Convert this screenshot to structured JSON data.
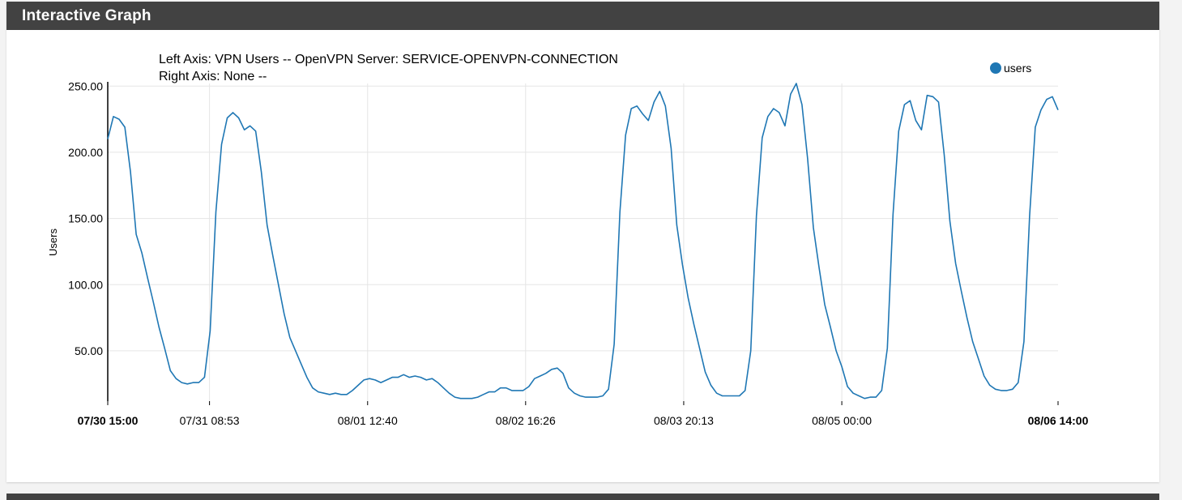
{
  "panel": {
    "title": "Interactive Graph"
  },
  "colors": {
    "header_bg": "#424242",
    "line": "#1f77b4",
    "grid": "#e5e5e5"
  },
  "chart_data": {
    "type": "line",
    "left_axis_title": "Left Axis: VPN Users -- OpenVPN Server: SERVICE-OPENVPN-CONNECTION",
    "right_axis_title": "Right Axis: None --",
    "ylabel": "Users",
    "ylim": [
      12,
      252
    ],
    "y_ticks": [
      {
        "value": 50,
        "label": "50.00"
      },
      {
        "value": 100,
        "label": "100.00"
      },
      {
        "value": 150,
        "label": "150.00"
      },
      {
        "value": 200,
        "label": "200.00"
      },
      {
        "value": 250,
        "label": "250.00"
      }
    ],
    "xlim": [
      "2019-07-30T15:00",
      "2019-08-06T14:00"
    ],
    "x_ticks": [
      {
        "t": "2019-07-30T15:00",
        "label": "07/30 15:00",
        "bold": true
      },
      {
        "t": "2019-07-31T08:53",
        "label": "07/31 08:53",
        "bold": false
      },
      {
        "t": "2019-08-01T12:40",
        "label": "08/01 12:40",
        "bold": false
      },
      {
        "t": "2019-08-02T16:26",
        "label": "08/02 16:26",
        "bold": false
      },
      {
        "t": "2019-08-03T20:13",
        "label": "08/03 20:13",
        "bold": false
      },
      {
        "t": "2019-08-05T00:00",
        "label": "08/05 00:00",
        "bold": false
      },
      {
        "t": "2019-08-06T14:00",
        "label": "08/06 14:00",
        "bold": true
      }
    ],
    "legend": {
      "position": "top-right"
    },
    "series": [
      {
        "name": "users",
        "color": "#1f77b4",
        "points": [
          [
            "2019-07-30T15:00",
            210
          ],
          [
            "2019-07-30T16:00",
            227
          ],
          [
            "2019-07-30T17:00",
            225
          ],
          [
            "2019-07-30T18:00",
            219
          ],
          [
            "2019-07-30T19:00",
            185
          ],
          [
            "2019-07-30T20:00",
            138
          ],
          [
            "2019-07-30T21:00",
            124
          ],
          [
            "2019-07-30T22:00",
            105
          ],
          [
            "2019-07-30T23:00",
            87
          ],
          [
            "2019-07-31T00:00",
            68
          ],
          [
            "2019-07-31T01:00",
            52
          ],
          [
            "2019-07-31T02:00",
            35
          ],
          [
            "2019-07-31T03:00",
            29
          ],
          [
            "2019-07-31T04:00",
            26
          ],
          [
            "2019-07-31T05:00",
            25
          ],
          [
            "2019-07-31T06:00",
            26
          ],
          [
            "2019-07-31T07:00",
            26
          ],
          [
            "2019-07-31T08:00",
            30
          ],
          [
            "2019-07-31T09:00",
            65
          ],
          [
            "2019-07-31T10:00",
            155
          ],
          [
            "2019-07-31T11:00",
            206
          ],
          [
            "2019-07-31T12:00",
            226
          ],
          [
            "2019-07-31T13:00",
            230
          ],
          [
            "2019-07-31T14:00",
            226
          ],
          [
            "2019-07-31T15:00",
            217
          ],
          [
            "2019-07-31T16:00",
            220
          ],
          [
            "2019-07-31T17:00",
            216
          ],
          [
            "2019-07-31T18:00",
            185
          ],
          [
            "2019-07-31T19:00",
            145
          ],
          [
            "2019-07-31T20:00",
            122
          ],
          [
            "2019-07-31T21:00",
            100
          ],
          [
            "2019-07-31T22:00",
            78
          ],
          [
            "2019-07-31T23:00",
            60
          ],
          [
            "2019-08-01T00:00",
            50
          ],
          [
            "2019-08-01T01:00",
            40
          ],
          [
            "2019-08-01T02:00",
            30
          ],
          [
            "2019-08-01T03:00",
            22
          ],
          [
            "2019-08-01T04:00",
            19
          ],
          [
            "2019-08-01T05:00",
            18
          ],
          [
            "2019-08-01T06:00",
            17
          ],
          [
            "2019-08-01T07:00",
            18
          ],
          [
            "2019-08-01T08:00",
            17
          ],
          [
            "2019-08-01T09:00",
            17
          ],
          [
            "2019-08-01T10:00",
            20
          ],
          [
            "2019-08-01T11:00",
            24
          ],
          [
            "2019-08-01T12:00",
            28
          ],
          [
            "2019-08-01T13:00",
            29
          ],
          [
            "2019-08-01T14:00",
            28
          ],
          [
            "2019-08-01T15:00",
            26
          ],
          [
            "2019-08-01T16:00",
            28
          ],
          [
            "2019-08-01T17:00",
            30
          ],
          [
            "2019-08-01T18:00",
            30
          ],
          [
            "2019-08-01T19:00",
            32
          ],
          [
            "2019-08-01T20:00",
            30
          ],
          [
            "2019-08-01T21:00",
            31
          ],
          [
            "2019-08-01T22:00",
            30
          ],
          [
            "2019-08-01T23:00",
            28
          ],
          [
            "2019-08-02T00:00",
            29
          ],
          [
            "2019-08-02T01:00",
            26
          ],
          [
            "2019-08-02T02:00",
            22
          ],
          [
            "2019-08-02T03:00",
            18
          ],
          [
            "2019-08-02T04:00",
            15
          ],
          [
            "2019-08-02T05:00",
            14
          ],
          [
            "2019-08-02T06:00",
            14
          ],
          [
            "2019-08-02T07:00",
            14
          ],
          [
            "2019-08-02T08:00",
            15
          ],
          [
            "2019-08-02T09:00",
            17
          ],
          [
            "2019-08-02T10:00",
            19
          ],
          [
            "2019-08-02T11:00",
            19
          ],
          [
            "2019-08-02T12:00",
            22
          ],
          [
            "2019-08-02T13:00",
            22
          ],
          [
            "2019-08-02T14:00",
            20
          ],
          [
            "2019-08-02T15:00",
            20
          ],
          [
            "2019-08-02T16:00",
            20
          ],
          [
            "2019-08-02T17:00",
            23
          ],
          [
            "2019-08-02T18:00",
            29
          ],
          [
            "2019-08-02T19:00",
            31
          ],
          [
            "2019-08-02T20:00",
            33
          ],
          [
            "2019-08-02T21:00",
            36
          ],
          [
            "2019-08-02T22:00",
            37
          ],
          [
            "2019-08-02T23:00",
            33
          ],
          [
            "2019-08-03T00:00",
            22
          ],
          [
            "2019-08-03T01:00",
            18
          ],
          [
            "2019-08-03T02:00",
            16
          ],
          [
            "2019-08-03T03:00",
            15
          ],
          [
            "2019-08-03T04:00",
            15
          ],
          [
            "2019-08-03T05:00",
            15
          ],
          [
            "2019-08-03T06:00",
            16
          ],
          [
            "2019-08-03T07:00",
            21
          ],
          [
            "2019-08-03T08:00",
            55
          ],
          [
            "2019-08-03T09:00",
            155
          ],
          [
            "2019-08-03T10:00",
            213
          ],
          [
            "2019-08-03T11:00",
            233
          ],
          [
            "2019-08-03T12:00",
            235
          ],
          [
            "2019-08-03T13:00",
            229
          ],
          [
            "2019-08-03T14:00",
            224
          ],
          [
            "2019-08-03T15:00",
            238
          ],
          [
            "2019-08-03T16:00",
            246
          ],
          [
            "2019-08-03T17:00",
            235
          ],
          [
            "2019-08-03T18:00",
            203
          ],
          [
            "2019-08-03T19:00",
            145
          ],
          [
            "2019-08-03T20:00",
            115
          ],
          [
            "2019-08-03T21:00",
            90
          ],
          [
            "2019-08-03T22:00",
            70
          ],
          [
            "2019-08-03T23:00",
            52
          ],
          [
            "2019-08-04T00:00",
            34
          ],
          [
            "2019-08-04T01:00",
            24
          ],
          [
            "2019-08-04T02:00",
            18
          ],
          [
            "2019-08-04T03:00",
            16
          ],
          [
            "2019-08-04T04:00",
            16
          ],
          [
            "2019-08-04T05:00",
            16
          ],
          [
            "2019-08-04T06:00",
            16
          ],
          [
            "2019-08-04T07:00",
            20
          ],
          [
            "2019-08-04T08:00",
            50
          ],
          [
            "2019-08-04T09:00",
            152
          ],
          [
            "2019-08-04T10:00",
            211
          ],
          [
            "2019-08-04T11:00",
            227
          ],
          [
            "2019-08-04T12:00",
            233
          ],
          [
            "2019-08-04T13:00",
            230
          ],
          [
            "2019-08-04T14:00",
            220
          ],
          [
            "2019-08-04T15:00",
            244
          ],
          [
            "2019-08-04T16:00",
            252
          ],
          [
            "2019-08-04T17:00",
            236
          ],
          [
            "2019-08-04T18:00",
            195
          ],
          [
            "2019-08-04T19:00",
            143
          ],
          [
            "2019-08-04T20:00",
            113
          ],
          [
            "2019-08-04T21:00",
            85
          ],
          [
            "2019-08-04T22:00",
            68
          ],
          [
            "2019-08-04T23:00",
            50
          ],
          [
            "2019-08-05T00:00",
            38
          ],
          [
            "2019-08-05T01:00",
            23
          ],
          [
            "2019-08-05T02:00",
            18
          ],
          [
            "2019-08-05T03:00",
            16
          ],
          [
            "2019-08-05T04:00",
            14
          ],
          [
            "2019-08-05T05:00",
            15
          ],
          [
            "2019-08-05T06:00",
            15
          ],
          [
            "2019-08-05T07:00",
            20
          ],
          [
            "2019-08-05T08:00",
            52
          ],
          [
            "2019-08-05T09:00",
            153
          ],
          [
            "2019-08-05T10:00",
            216
          ],
          [
            "2019-08-05T11:00",
            236
          ],
          [
            "2019-08-05T12:00",
            239
          ],
          [
            "2019-08-05T13:00",
            224
          ],
          [
            "2019-08-05T14:00",
            217
          ],
          [
            "2019-08-05T15:00",
            243
          ],
          [
            "2019-08-05T16:00",
            242
          ],
          [
            "2019-08-05T17:00",
            238
          ],
          [
            "2019-08-05T18:00",
            198
          ],
          [
            "2019-08-05T19:00",
            148
          ],
          [
            "2019-08-05T20:00",
            116
          ],
          [
            "2019-08-05T21:00",
            95
          ],
          [
            "2019-08-05T22:00",
            75
          ],
          [
            "2019-08-05T23:00",
            57
          ],
          [
            "2019-08-06T00:00",
            44
          ],
          [
            "2019-08-06T01:00",
            31
          ],
          [
            "2019-08-06T02:00",
            24
          ],
          [
            "2019-08-06T03:00",
            21
          ],
          [
            "2019-08-06T04:00",
            20
          ],
          [
            "2019-08-06T05:00",
            20
          ],
          [
            "2019-08-06T06:00",
            21
          ],
          [
            "2019-08-06T07:00",
            26
          ],
          [
            "2019-08-06T08:00",
            57
          ],
          [
            "2019-08-06T09:00",
            152
          ],
          [
            "2019-08-06T10:00",
            219
          ],
          [
            "2019-08-06T11:00",
            232
          ],
          [
            "2019-08-06T12:00",
            240
          ],
          [
            "2019-08-06T13:00",
            242
          ],
          [
            "2019-08-06T14:00",
            232
          ]
        ]
      }
    ]
  }
}
